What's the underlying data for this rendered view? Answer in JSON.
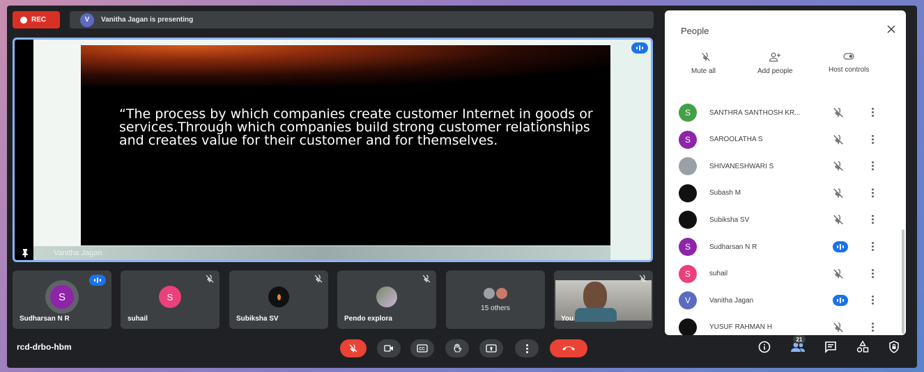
{
  "recording": {
    "label": "REC"
  },
  "presenting_bar": {
    "avatar_initial": "V",
    "text": "Vanitha Jagan is presenting"
  },
  "stage": {
    "slide_text": "“The process by which companies create customer Internet in goods or services.Through which companies build strong customer relationships and creates value for their customer and for themselves.",
    "presenter_name": "Vanitha Jagan"
  },
  "tiles": [
    {
      "name": "Sudharsan N R",
      "initial": "S",
      "color": "#8e24aa",
      "speaking": true
    },
    {
      "name": "suhail",
      "initial": "S",
      "color": "#ec407a",
      "speaking": false
    },
    {
      "name": "Subiksha SV",
      "initial": "",
      "color": "#111111",
      "speaking": false
    },
    {
      "name": "Pendo explora",
      "initial": "",
      "color": "#9e9e9e",
      "speaking": false
    },
    {
      "name": "15 others"
    },
    {
      "name": "You"
    }
  ],
  "meeting_code": "rcd-drbo-hbm",
  "participant_count": "21",
  "people_panel": {
    "title": "People",
    "actions": {
      "mute_all": "Mute all",
      "add_people": "Add people",
      "host_controls": "Host controls"
    },
    "participants": [
      {
        "name": "SANTHRA SANTHOSH KR...",
        "initial": "S",
        "color": "#43a047",
        "speaking": false
      },
      {
        "name": "SAROOLATHA S",
        "initial": "S",
        "color": "#8e24aa",
        "speaking": false
      },
      {
        "name": "SHIVANESHWARI S",
        "initial": "",
        "color": "#9aa0a6",
        "speaking": false
      },
      {
        "name": "Subash M",
        "initial": "",
        "color": "#111111",
        "speaking": false
      },
      {
        "name": "Subiksha SV",
        "initial": "",
        "color": "#111111",
        "speaking": false
      },
      {
        "name": "Sudharsan N R",
        "initial": "S",
        "color": "#8e24aa",
        "speaking": true
      },
      {
        "name": "suhail",
        "initial": "S",
        "color": "#ec407a",
        "speaking": false
      },
      {
        "name": "Vanitha Jagan",
        "initial": "V",
        "color": "#5c6bc0",
        "speaking": true
      },
      {
        "name": "YUSUF RAHMAN H",
        "initial": "",
        "color": "#111111",
        "speaking": false
      }
    ]
  },
  "colors": {
    "accent": "#1a73e8",
    "danger": "#ea4335",
    "surface": "#3c4043",
    "background": "#202124"
  }
}
